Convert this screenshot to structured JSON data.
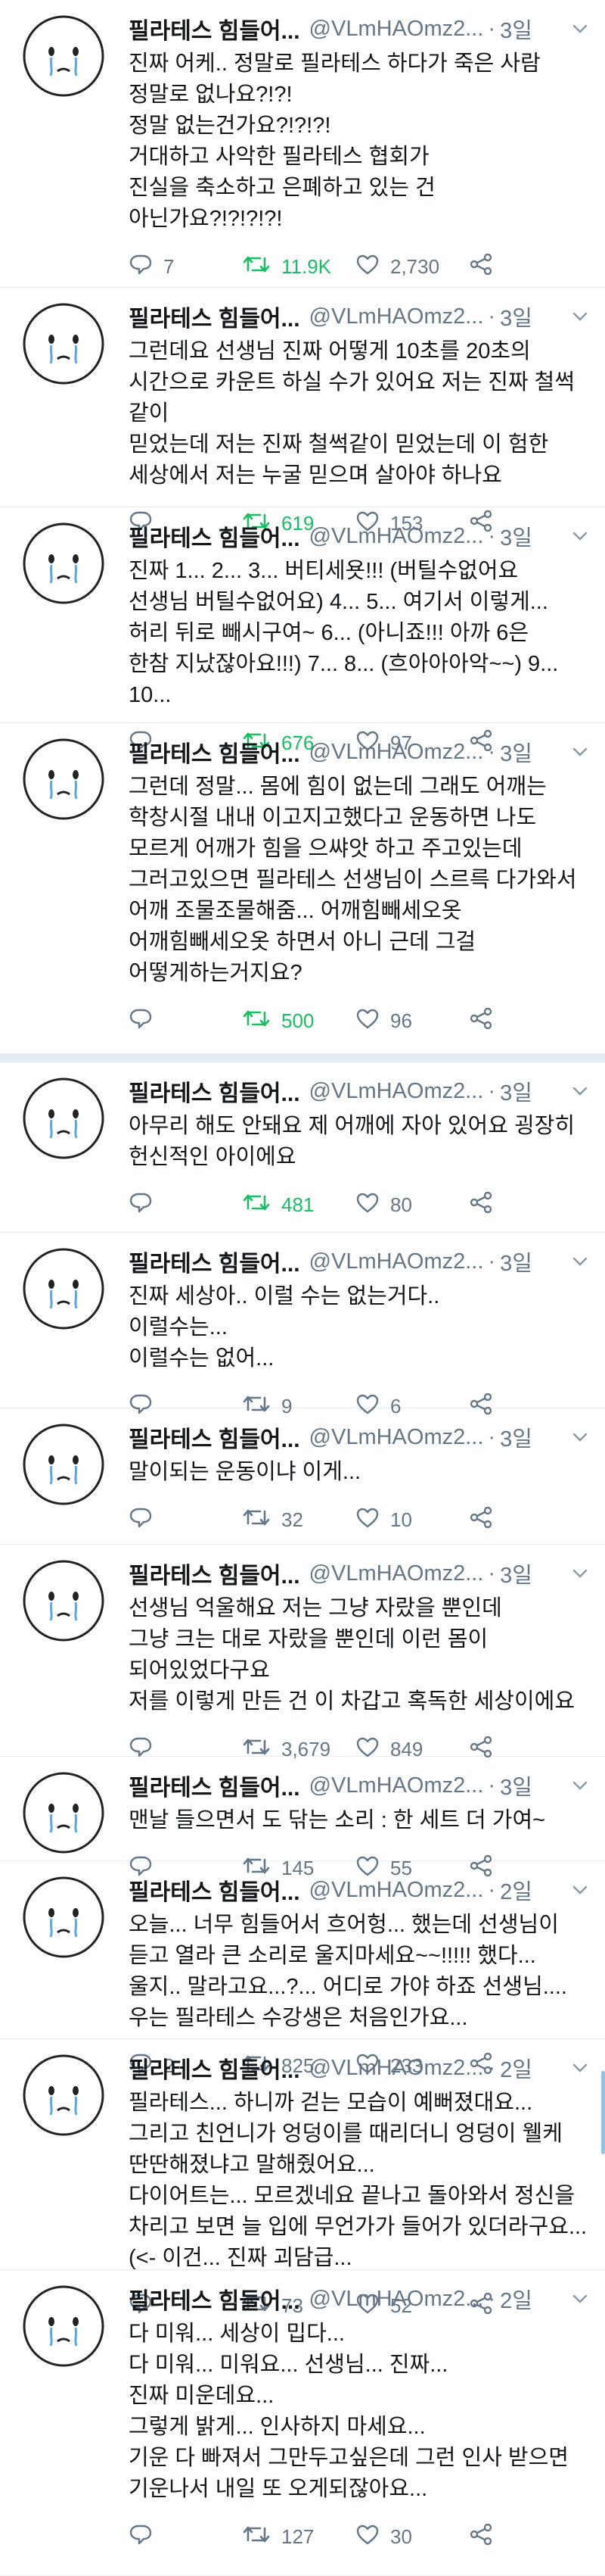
{
  "colors": {
    "retweet_active": "#17bf63",
    "meta_gray": "#657786",
    "divider": "#e6ecf0",
    "text": "#14171a",
    "scroll_indicator": "#8fc2ef"
  },
  "icons": {
    "avatar": "crying-face-avatar",
    "caret": "chevron-down-icon",
    "reply": "reply-icon",
    "retweet": "retweet-icon",
    "like": "heart-icon",
    "share": "share-icon"
  },
  "tweets": [
    {
      "name": "필라테스 힘들어...",
      "handle": "@VLmHAOmz2...",
      "time": "3일",
      "text": "진짜 어케.. 정말로 필라테스 하다가 죽은 사람\n정말로 없나요?!?!\n정말 없는건가요?!?!?!\n거대하고 사악한 필라테스 협회가\n진실을 축소하고 은폐하고 있는 건\n아닌가요?!?!?!?!",
      "replies": "7",
      "retweets": "11.9K",
      "likes": "2,730",
      "retweeted": true
    },
    {
      "name": "필라테스 힘들어...",
      "handle": "@VLmHAOmz2...",
      "time": "3일",
      "text": "그런데요 선생님 진짜 어떻게 10초를 20초의\n시간으로 카운트 하실 수가 있어요 저는 진짜 철썩같이\n믿었는데 저는 진짜 철썩같이 믿었는데 이 험한\n세상에서 저는 누굴 믿으며 살아야 하나요",
      "replies": "",
      "retweets": "619",
      "likes": "153",
      "retweeted": true
    },
    {
      "name": "필라테스 힘들어...",
      "handle": "@VLmHAOmz2...",
      "time": "3일",
      "text": "진짜 1... 2... 3... 버티세욧!!! (버틸수없어요\n선생님 버틸수없어요) 4... 5... 여기서 이렇게...\n허리 뒤로 빼시구여~ 6... (아니죠!!! 아까 6은\n한참 지났잖아요!!!) 7... 8... (흐아아아악~~) 9...\n10...",
      "replies": "",
      "retweets": "676",
      "likes": "97",
      "retweeted": true
    },
    {
      "name": "필라테스 힘들어...",
      "handle": "@VLmHAOmz2...",
      "time": "3일",
      "text": "그런데 정말... 몸에 힘이 없는데 그래도 어깨는\n학창시절 내내 이고지고했다고 운동하면 나도\n모르게 어깨가 힘을 으쌰앗 하고 주고있는데\n그러고있으면 필라테스 선생님이 스르륵 다가와서\n어깨 조물조물해줌... 어깨힘빼세오옷\n어깨힘빼세오옷 하면서 아니 근데 그걸\n어떻게하는거지요?",
      "replies": "",
      "retweets": "500",
      "likes": "96",
      "retweeted": true
    },
    {
      "name": "필라테스 힘들어...",
      "handle": "@VLmHAOmz2...",
      "time": "3일",
      "text": "아무리 해도 안돼요 제 어깨에 자아 있어요 굉장히\n헌신적인 아이에요",
      "replies": "",
      "retweets": "481",
      "likes": "80",
      "retweeted": true
    },
    {
      "name": "필라테스 힘들어...",
      "handle": "@VLmHAOmz2...",
      "time": "3일",
      "text": "진짜 세상아.. 이럴 수는 없는거다..\n이럴수는...\n이럴수는 없어...",
      "replies": "",
      "retweets": "9",
      "likes": "6",
      "retweeted": false
    },
    {
      "name": "필라테스 힘들어...",
      "handle": "@VLmHAOmz2...",
      "time": "3일",
      "text": "말이되는 운동이냐 이게...",
      "replies": "",
      "retweets": "32",
      "likes": "10",
      "retweeted": false
    },
    {
      "name": "필라테스 힘들어...",
      "handle": "@VLmHAOmz2...",
      "time": "3일",
      "text": "선생님 억울해요 저는 그냥 자랐을 뿐인데\n그냥 크는 대로 자랐을 뿐인데 이런 몸이\n되어있었다구요\n저를 이렇게 만든 건 이 차갑고 혹독한 세상이에요",
      "replies": "",
      "retweets": "3,679",
      "likes": "849",
      "retweeted": false
    },
    {
      "name": "필라테스 힘들어...",
      "handle": "@VLmHAOmz2...",
      "time": "3일",
      "text": "맨날 들으면서 도 닦는 소리 : 한 세트 더 가여~",
      "replies": "",
      "retweets": "145",
      "likes": "55",
      "retweeted": false
    },
    {
      "name": "필라테스 힘들어...",
      "handle": "@VLmHAOmz2...",
      "time": "2일",
      "text": "오늘... 너무 힘들어서 흐어헝... 했는데 선생님이\n듣고 열라 큰 소리로 울지마세요~~!!!!! 했다...\n울지.. 말라고요...?... 어디로 가야 하죠 선생님....\n우는 필라테스 수강생은 처음인가요...",
      "replies": "2",
      "retweets": "825",
      "likes": "233",
      "retweeted": false
    },
    {
      "name": "필라테스 힘들어...",
      "handle": "@VLmHAOmz2...",
      "time": "2일",
      "text": "필라테스... 하니까 걷는 모습이 예뻐졌대요...\n그리고 친언니가 엉덩이를 때리더니 엉덩이 웰케\n딴딴해졌냐고 말해줬어요...\n다이어트는... 모르겠네요 끝나고 돌아와서 정신을\n차리고 보면 늘 입에 무언가가 들어가 있더라구요...\n(<- 이건... 진짜 괴담급...",
      "replies": "",
      "retweets": "73",
      "likes": "52",
      "retweeted": false
    },
    {
      "name": "필라테스 힘들어...",
      "handle": "@VLmHAOmz2...",
      "time": "2일",
      "text": "다 미워... 세상이 밉다...\n다 미워... 미워요... 선생님... 진짜...\n진짜 미운데요...\n그렇게 밝게... 인사하지 마세요...\n기운 다 빠져서 그만두고싶은데 그런 인사 받으면\n기운나서 내일 또 오게되잖아요...",
      "replies": "",
      "retweets": "127",
      "likes": "30",
      "retweeted": false
    }
  ]
}
